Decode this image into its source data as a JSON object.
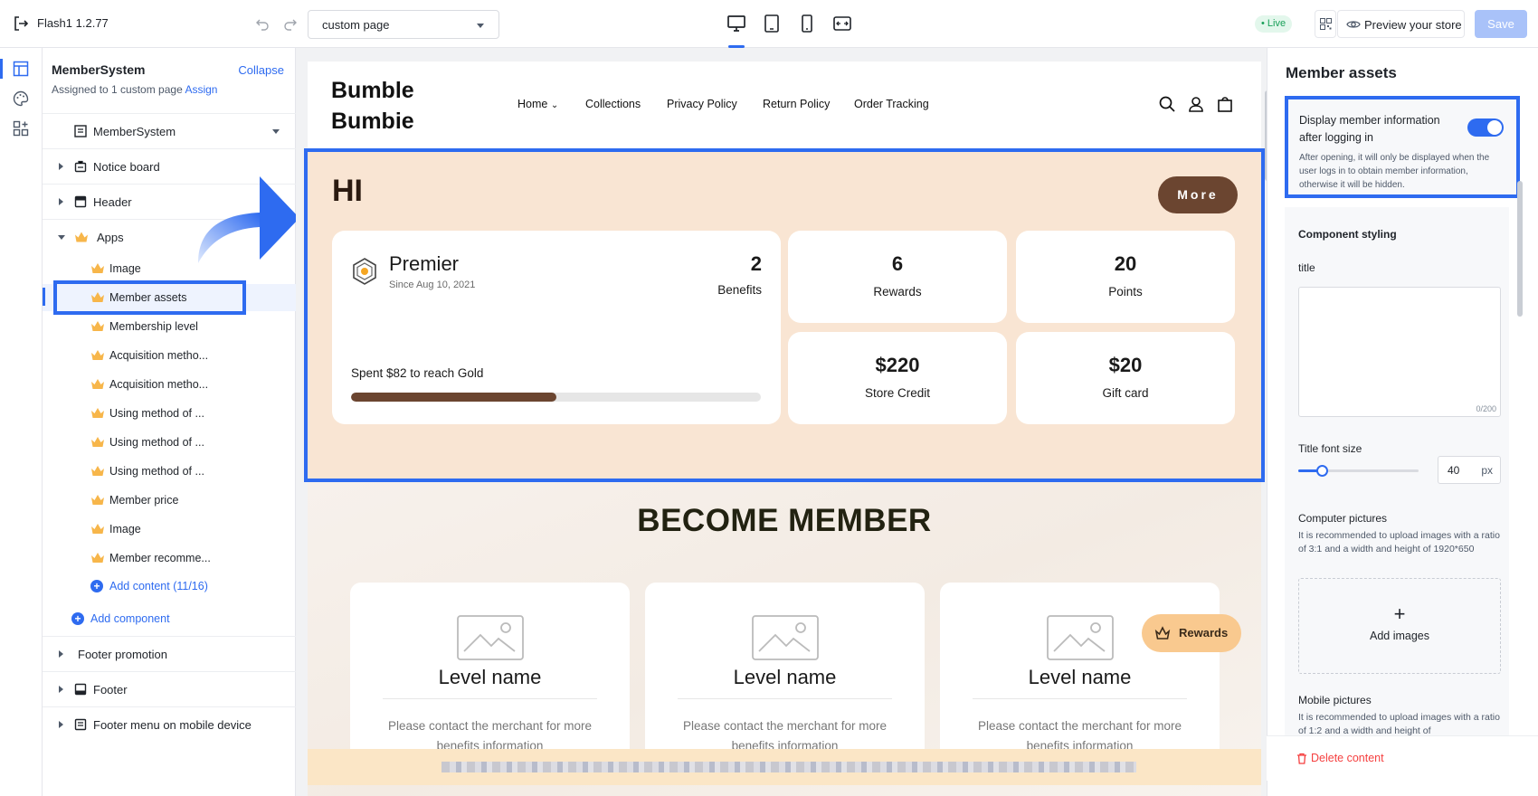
{
  "topbar": {
    "app_name": "Flash1  1.2.77",
    "page_select": "custom page",
    "live_badge": "• Live",
    "preview_label": "Preview your store",
    "save_label": "Save"
  },
  "left_panel": {
    "title": "MemberSystem",
    "collapse_label": "Collapse",
    "assigned_text": "Assigned to 1 custom page",
    "assign_link": "Assign",
    "template_select": "MemberSystem",
    "sections": [
      {
        "label": "Notice board"
      },
      {
        "label": "Header"
      },
      {
        "label": "Apps"
      }
    ],
    "apps": [
      "Image",
      "Member assets",
      "Membership level",
      "Acquisition metho...",
      "Acquisition metho...",
      "Using method of ...",
      "Using method of ...",
      "Using method of ...",
      "Member price",
      "Image",
      "Member recomme..."
    ],
    "add_content": "Add content (11/16)",
    "add_component": "Add component",
    "footer_sections": [
      {
        "label": "Footer promotion"
      },
      {
        "label": "Footer"
      },
      {
        "label": "Footer menu on mobile device"
      }
    ]
  },
  "store": {
    "brand": "Bumble Bumbie",
    "nav": [
      "Home",
      "Collections",
      "Privacy Policy",
      "Return Policy",
      "Order Tracking"
    ],
    "hero": {
      "greeting": "HI",
      "more_label": "More",
      "tier": "Premier",
      "since": "Since Aug 10, 2021",
      "benefits_count": "2",
      "benefits_label": "Benefits",
      "spent_text": "Spent $82 to reach Gold",
      "progress": 0.5,
      "stats": [
        {
          "value": "6",
          "label": "Rewards"
        },
        {
          "value": "20",
          "label": "Points"
        },
        {
          "value": "$220",
          "label": "Store Credit"
        },
        {
          "value": "$20",
          "label": "Gift card"
        }
      ]
    },
    "become_member": {
      "title": "BECOME MEMBER",
      "levels": [
        {
          "name": "Level name",
          "desc": "Please contact the merchant for more benefits information"
        },
        {
          "name": "Level name",
          "desc": "Please contact the merchant for more benefits information"
        },
        {
          "name": "Level name",
          "desc": "Please contact the merchant for more benefits information"
        }
      ]
    },
    "rewards_button": "Rewards"
  },
  "right_panel": {
    "title": "Member assets",
    "toggle_title": "Display member information after logging in",
    "toggle_on": true,
    "toggle_desc": "After opening, it will only be displayed when the user logs in to obtain member information, otherwise it will be hidden.",
    "component_styling": "Component styling",
    "title_label": "title",
    "title_value": "",
    "title_count": "0/200",
    "font_size_label": "Title font size",
    "font_size_value": "40",
    "font_size_unit": "px",
    "computer_pictures_label": "Computer pictures",
    "computer_pictures_hint": "It is recommended to upload images with a ratio of 3:1 and a width and height of 1920*650",
    "add_images": "Add images",
    "mobile_pictures_label": "Mobile pictures",
    "mobile_pictures_hint": "It is recommended to upload images with a ratio of 1:2 and a width and height of",
    "delete_label": "Delete content"
  },
  "colors": {
    "accent": "#2e6bf0",
    "hero_bg": "#f9e5d3",
    "brown": "#6b4530",
    "danger": "#f53f3f"
  }
}
